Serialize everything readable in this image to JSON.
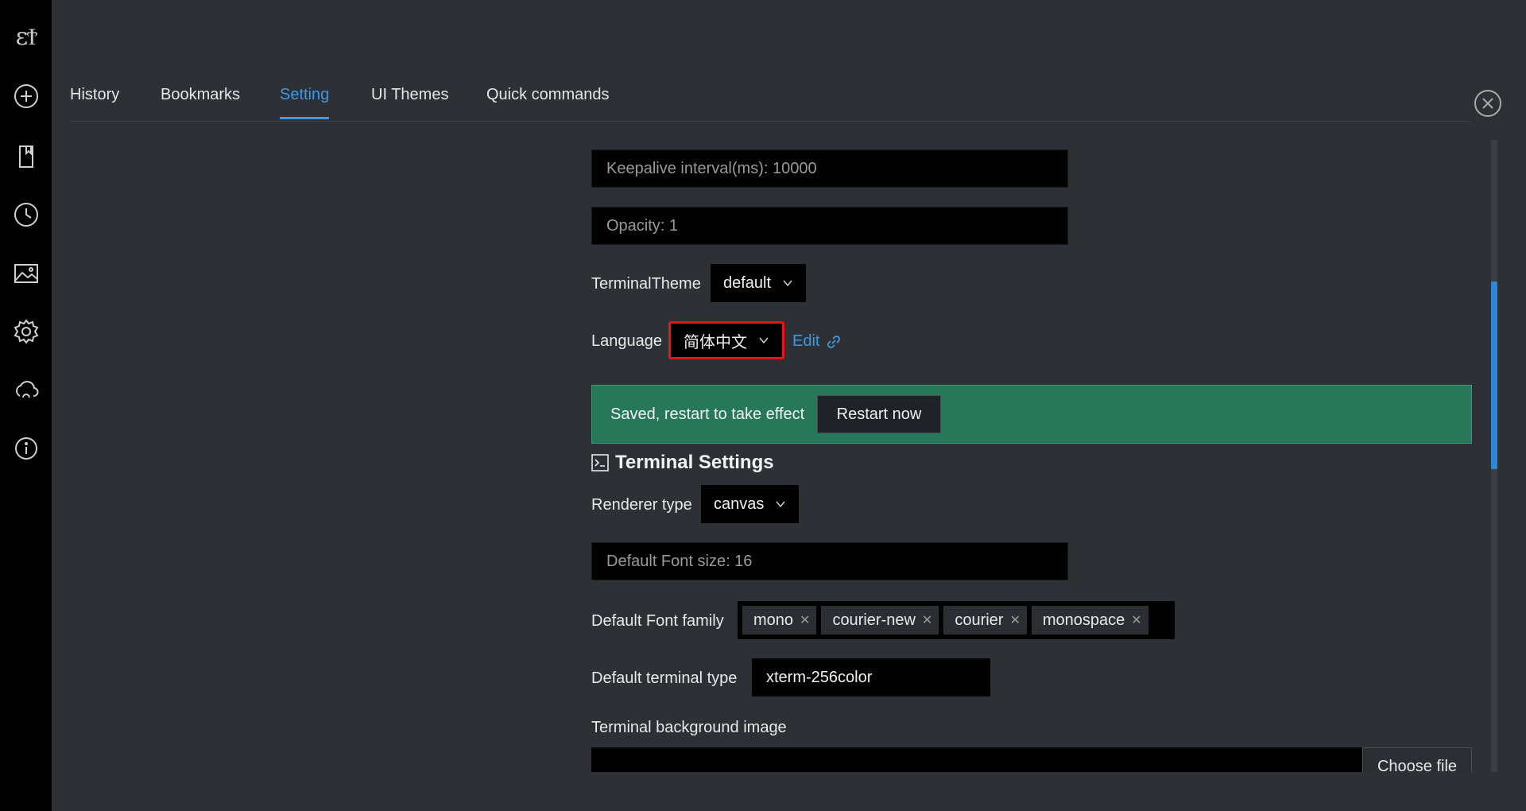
{
  "sidebar": {
    "logo_text": "ɛϮ",
    "icons": [
      "plus-circle-icon",
      "book-icon",
      "clock-icon",
      "image-icon",
      "gear-icon",
      "cloud-icon",
      "info-icon"
    ]
  },
  "tabs": [
    {
      "label": "History"
    },
    {
      "label": "Bookmarks"
    },
    {
      "label": "Setting",
      "active": true
    },
    {
      "label": "UI Themes"
    },
    {
      "label": "Quick commands"
    }
  ],
  "settings": {
    "keepalive": "Keepalive interval(ms): 10000",
    "opacity": "Opacity: 1",
    "terminal_theme_label": "TerminalTheme",
    "terminal_theme_value": "default",
    "language_label": "Language",
    "language_value": "简体中文",
    "edit_label": "Edit",
    "banner_text": "Saved, restart to take effect",
    "restart_label": "Restart now",
    "terminal_section_title": "Terminal Settings",
    "renderer_label": "Renderer type",
    "renderer_value": "canvas",
    "font_size": "Default Font size: 16",
    "font_family_label": "Default Font family",
    "font_family_tags": [
      "mono",
      "courier-new",
      "courier",
      "monospace"
    ],
    "terminal_type_label": "Default terminal type",
    "terminal_type_value": "xterm-256color",
    "bg_image_label": "Terminal background image",
    "choose_file_label": "Choose file"
  },
  "colors": {
    "accent": "#3d98e6",
    "success_banner": "#27785a",
    "highlight_border": "#e8141a"
  }
}
